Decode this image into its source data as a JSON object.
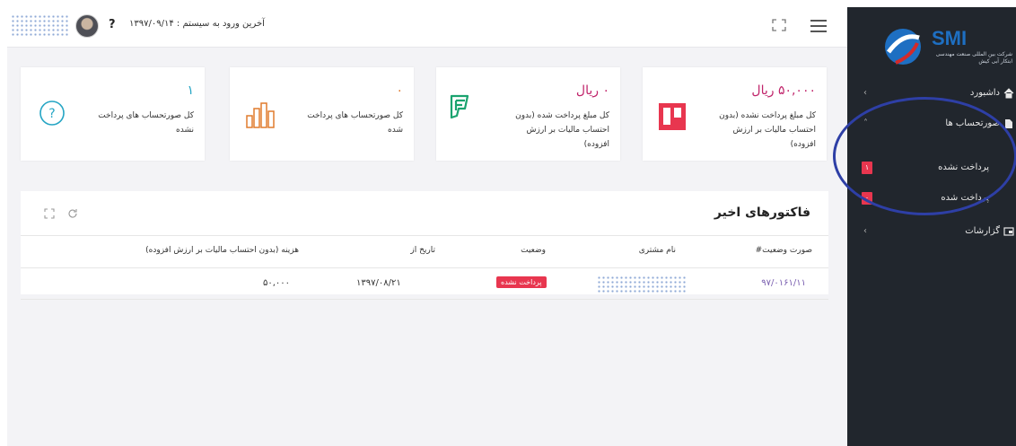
{
  "header": {
    "last_login": "آخرین ورود به سیستم : ۱۳۹۷/۰۹/۱۴",
    "help_symbol": "?",
    "user_icon": "user-avatar",
    "fullscreen_icon": "expand-icon",
    "menu_icon": "hamburger-icon"
  },
  "cards": [
    {
      "value": "۵۰,۰۰۰ ریال",
      "label": "کل مبلغ پرداخت نشده (بدون احتساب مالیات بر ارزش افزوده)",
      "icon": "trello-board-icon",
      "color": "#e8364f"
    },
    {
      "value": "۰ ریال",
      "label": "کل مبلغ پرداخت شده (بدون احتساب مالیات بر ارزش افزوده)",
      "icon": "foursquare-icon",
      "color": "#1aa36f"
    },
    {
      "value": "۰",
      "label": "کل صورتحساب های پرداخت شده",
      "icon": "bar-chart-icon",
      "color": "#e07b2d"
    },
    {
      "value": "۱",
      "label": "کل صورتحساب های پرداخت نشده",
      "icon": "question-circle-icon",
      "color": "#25a5c4"
    }
  ],
  "invoices_panel": {
    "title": "فاکتورهای اخیر",
    "columns": {
      "number": "صورت وضعیت#",
      "customer": "نام مشتری",
      "status": "وضعیت",
      "date": "تاریخ از",
      "amount": "هزینه (بدون احتساب مالیات بر ارزش افزوده)"
    },
    "rows": [
      {
        "number": "۹۷/۰۱۶۱/۱۱",
        "status": "پرداخت نشده",
        "date": "۱۳۹۷/۰۸/۲۱",
        "amount": "۵۰,۰۰۰"
      }
    ]
  },
  "sidebar": {
    "logo_text": "SMI",
    "logo_subtitle": "شرکت بین المللی صنعت مهندسی ابتکار آبی کیش",
    "items": [
      {
        "label": "داشبورد",
        "icon": "home-icon"
      },
      {
        "label": "صورتحساب ها",
        "icon": "file-icon"
      },
      {
        "label": "گزارشات",
        "icon": "report-icon"
      }
    ],
    "subitems": [
      {
        "label": "پرداخت نشده",
        "count": "۱"
      },
      {
        "label": "پرداخت شده",
        "count": "۰"
      }
    ]
  },
  "colors": {
    "accent": "#c0236a",
    "sidebar_bg": "#21262d",
    "badge_red": "#e8364f",
    "annotation": "#2e3fa6"
  }
}
